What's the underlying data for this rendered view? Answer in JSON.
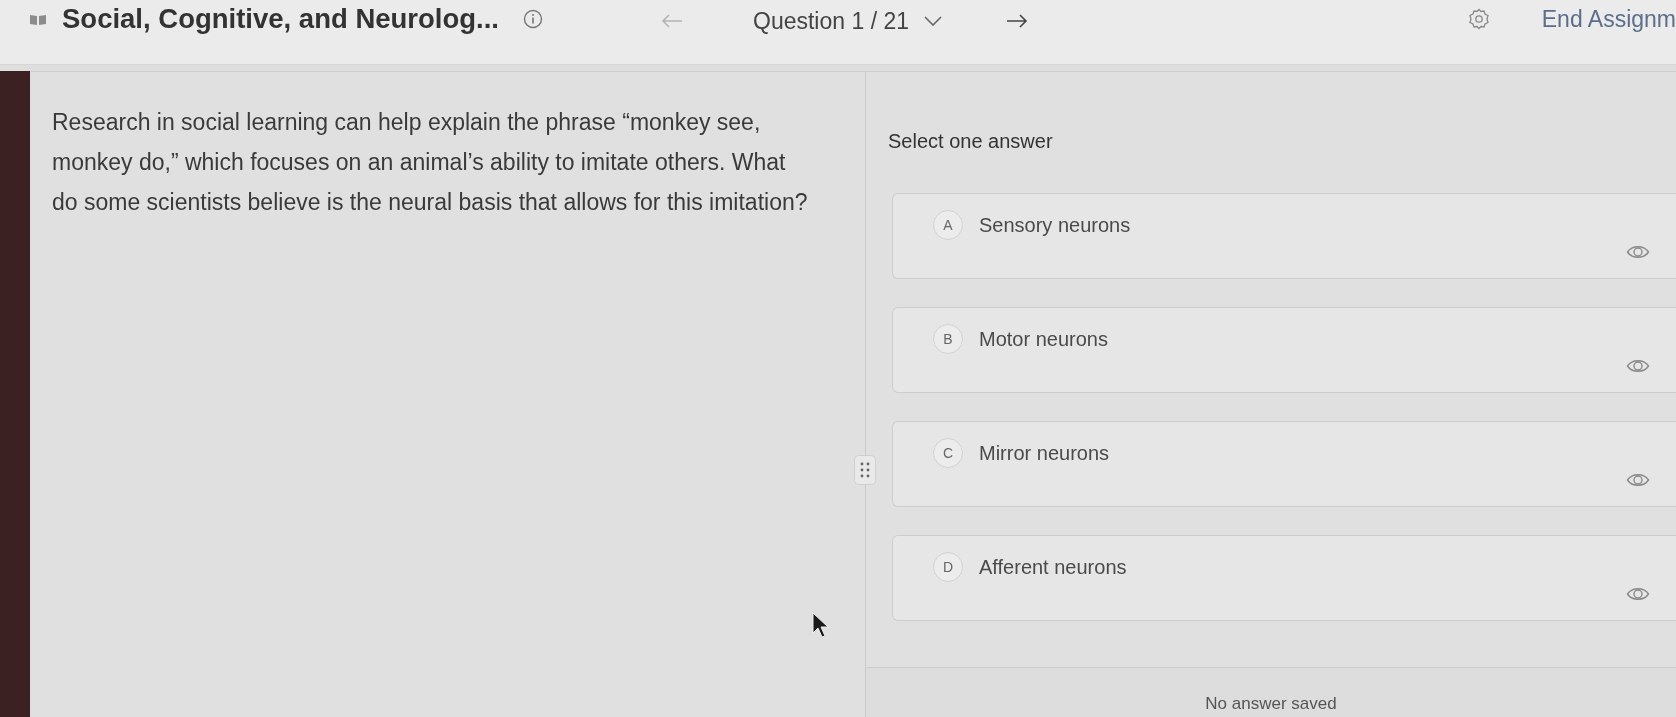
{
  "header": {
    "course_title": "Social, Cognitive, and Neurolog...",
    "question_label": "Question 1 / 21",
    "previous_disabled": true,
    "next_disabled": false,
    "end_button": "End Assignm"
  },
  "question": {
    "text": "Research in social learning can help explain the phrase “monkey see, monkey do,” which focuses on an animal’s ability to imitate others. What do some scientists believe is the neural basis that allows for this imitation?"
  },
  "answers": {
    "prompt": "Select one answer",
    "options": [
      {
        "letter": "A",
        "text": "Sensory neurons",
        "selected": false
      },
      {
        "letter": "B",
        "text": "Motor neurons",
        "selected": false
      },
      {
        "letter": "C",
        "text": "Mirror neurons",
        "selected": false
      },
      {
        "letter": "D",
        "text": "Afferent neurons",
        "selected": false
      }
    ]
  },
  "status": "No answer saved"
}
